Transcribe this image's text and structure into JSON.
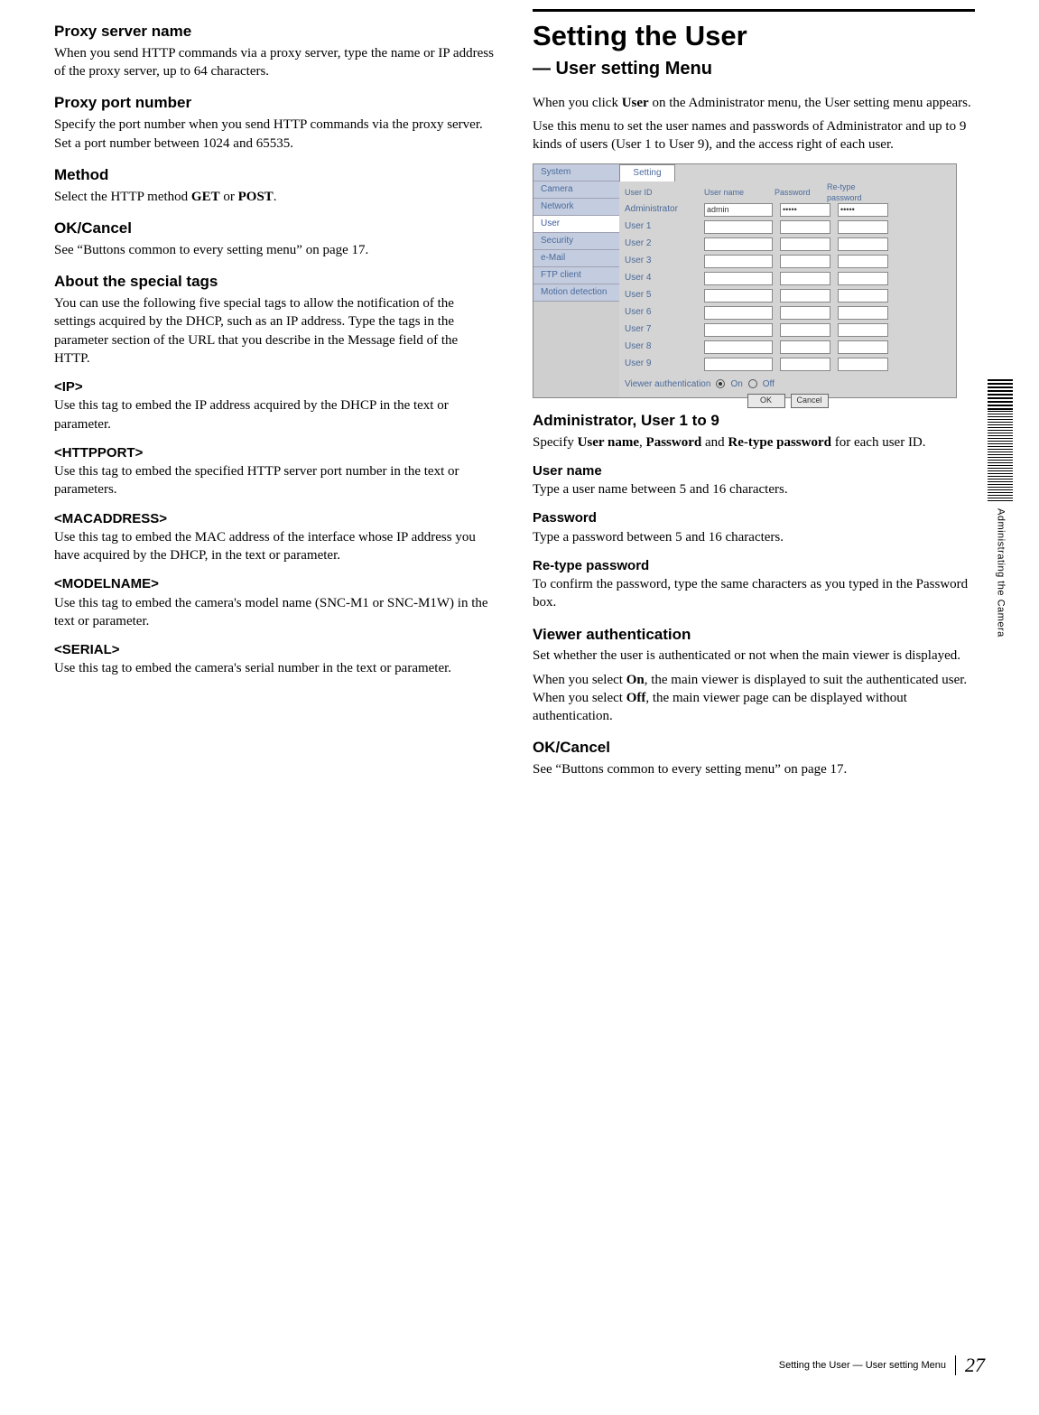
{
  "left": {
    "proxy_server_h": "Proxy server name",
    "proxy_server_t": "When you send HTTP commands via a proxy server, type the name or IP address of the proxy server, up to 64 characters.",
    "proxy_port_h": "Proxy port number",
    "proxy_port_t": "Specify the port number when you send HTTP commands via the proxy server.  Set a port number between 1024 and 65535.",
    "method_h": "Method",
    "method_t1": "Select the HTTP method ",
    "method_get": "GET",
    "method_or": " or ",
    "method_post": "POST",
    "method_dot": ".",
    "okcancel_h": "OK/Cancel",
    "okcancel_t": "See “Buttons common to every setting menu” on page 17.",
    "special_h": "About the special tags",
    "special_t": "You can use the following five special tags to allow the notification of the settings acquired by the DHCP, such as an IP address.  Type the tags in the parameter section of the URL that you describe in the Message field of the HTTP.",
    "ip_h": "<IP>",
    "ip_t": "Use this tag to embed the IP address acquired by the DHCP in the text or parameter.",
    "http_h": "<HTTPPORT>",
    "http_t": "Use this tag to embed the specified HTTP server port number in the text or parameters.",
    "mac_h": "<MACADDRESS>",
    "mac_t": "Use this tag to embed the MAC address of the interface whose IP address you have acquired by the DHCP, in the text or parameter.",
    "model_h": "<MODELNAME>",
    "model_t": "Use this tag to embed the camera's model name (SNC-M1 or SNC-M1W) in the text or parameter.",
    "serial_h": "<SERIAL>",
    "serial_t": "Use this tag to embed the camera's serial number in the text or parameter."
  },
  "right": {
    "title": "Setting the User",
    "subtitle": "— User setting Menu",
    "intro1a": "When you click ",
    "intro1_user": "User",
    "intro1b": " on the Administrator menu, the User setting menu appears.",
    "intro2": "Use this menu to set the user names and passwords of Administrator and up to 9 kinds of users (User 1 to User 9), and the access right of each user.",
    "admin_h": "Administrator, User 1 to 9",
    "admin_t1a": "Specify ",
    "admin_un": "User name",
    "admin_c1": ", ",
    "admin_pw": "Password",
    "admin_and": " and ",
    "admin_rt": "Re-type password",
    "admin_t1b": " for each user ID.",
    "un_h": "User name",
    "un_t": "Type a user name between 5 and 16 characters.",
    "pw_h": "Password",
    "pw_t": "Type a password between 5 and 16 characters.",
    "rt_h": "Re-type password",
    "rt_t": "To confirm the password, type the same characters as you typed in the Password box.",
    "va_h": "Viewer authentication",
    "va_t1": "Set whether the user is authenticated or not when the main viewer is displayed.",
    "va_t2a": "When you select ",
    "va_on": "On",
    "va_t2b": ", the main viewer is displayed to suit the authenticated user. When you select ",
    "va_off": "Off",
    "va_t2c": ", the main viewer page can be displayed without authentication.",
    "ok2_h": "OK/Cancel",
    "ok2_t": "See “Buttons common to every setting menu” on page 17."
  },
  "shot": {
    "side": [
      "System",
      "Camera",
      "Network",
      "User",
      "Security",
      "e-Mail",
      "FTP client",
      "Motion detection"
    ],
    "tab": "Setting",
    "head_userid": "User ID",
    "head_username": "User name",
    "head_password": "Password",
    "head_retype": "Re-type password",
    "rows": [
      "Administrator",
      "User 1",
      "User 2",
      "User 3",
      "User 4",
      "User 5",
      "User 6",
      "User 7",
      "User 8",
      "User 9"
    ],
    "admin_val": "admin",
    "dots": "•••••",
    "auth_label": "Viewer authentication",
    "auth_on": "On",
    "auth_off": "Off",
    "btn_ok": "OK",
    "btn_cancel": "Cancel"
  },
  "sidetab": "Administrating the Camera",
  "footer": {
    "text": "Setting the User — User setting Menu",
    "page": "27"
  }
}
